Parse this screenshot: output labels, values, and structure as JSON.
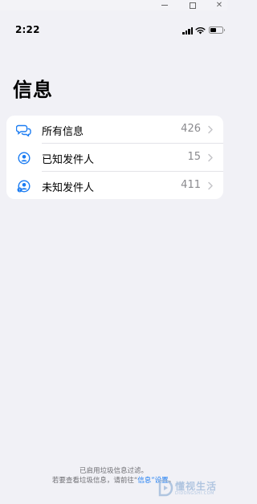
{
  "status_bar": {
    "time": "2:22"
  },
  "page": {
    "title": "信息"
  },
  "filters": [
    {
      "label": "所有信息",
      "count": "426",
      "icon": "chat-bubbles-icon"
    },
    {
      "label": "已知发件人",
      "count": "15",
      "icon": "person-circle-icon"
    },
    {
      "label": "未知发件人",
      "count": "411",
      "icon": "person-unknown-icon"
    }
  ],
  "footer": {
    "line1": "已启用垃圾信息过滤。",
    "line2_prefix": "若要查看垃圾信息，请前往“",
    "line2_link": "信息”设置",
    "line2_suffix": "。"
  },
  "watermark": {
    "text": "懂视生活",
    "sub": "DIDONGSHI.COM"
  },
  "colors": {
    "accent": "#1b7cf2",
    "background": "#f1f1f6",
    "card": "#ffffff",
    "secondary_text": "#8a8a8e"
  }
}
